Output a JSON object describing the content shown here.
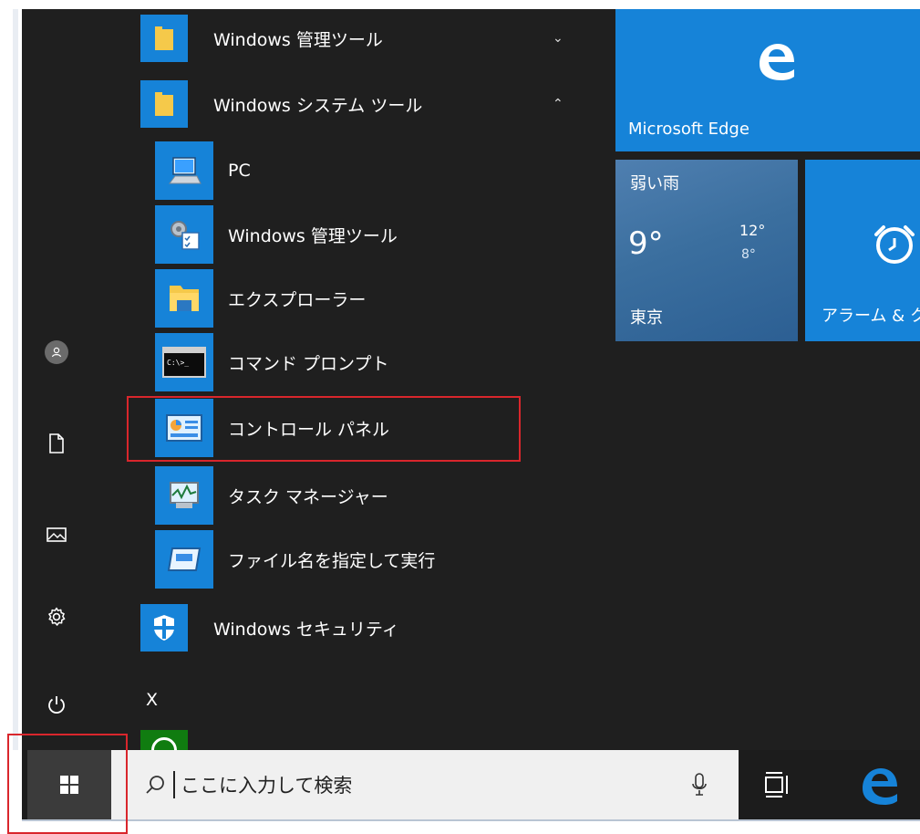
{
  "app_list": {
    "folders": [
      {
        "label": "Windows 管理ツール",
        "chevron": "chevron-down-icon"
      },
      {
        "label": "Windows システム ツール",
        "chevron": "chevron-up-icon"
      }
    ],
    "system_tools": [
      {
        "label": "PC",
        "icon": "pc-icon"
      },
      {
        "label": "Windows 管理ツール",
        "icon": "admin-tools-icon"
      },
      {
        "label": "エクスプローラー",
        "icon": "file-explorer-icon"
      },
      {
        "label": "コマンド プロンプト",
        "icon": "command-prompt-icon"
      },
      {
        "label": "コントロール パネル",
        "icon": "control-panel-icon"
      },
      {
        "label": "タスク マネージャー",
        "icon": "task-manager-icon"
      },
      {
        "label": "ファイル名を指定して実行",
        "icon": "run-icon"
      }
    ],
    "security": {
      "label": "Windows セキュリティ"
    },
    "letter_heading": "X"
  },
  "tiles": {
    "edge": {
      "label": "Microsoft Edge"
    },
    "weather": {
      "condition": "弱い雨",
      "temperature": "9°",
      "high": "12°",
      "low": "8°",
      "city": "東京"
    },
    "alarm": {
      "label": "アラーム & ク"
    }
  },
  "taskbar": {
    "search_placeholder": "ここに入力して検索"
  },
  "colors": {
    "accent": "#1683d8",
    "menu_bg": "#1f1f1f",
    "highlight": "#d9262c"
  }
}
